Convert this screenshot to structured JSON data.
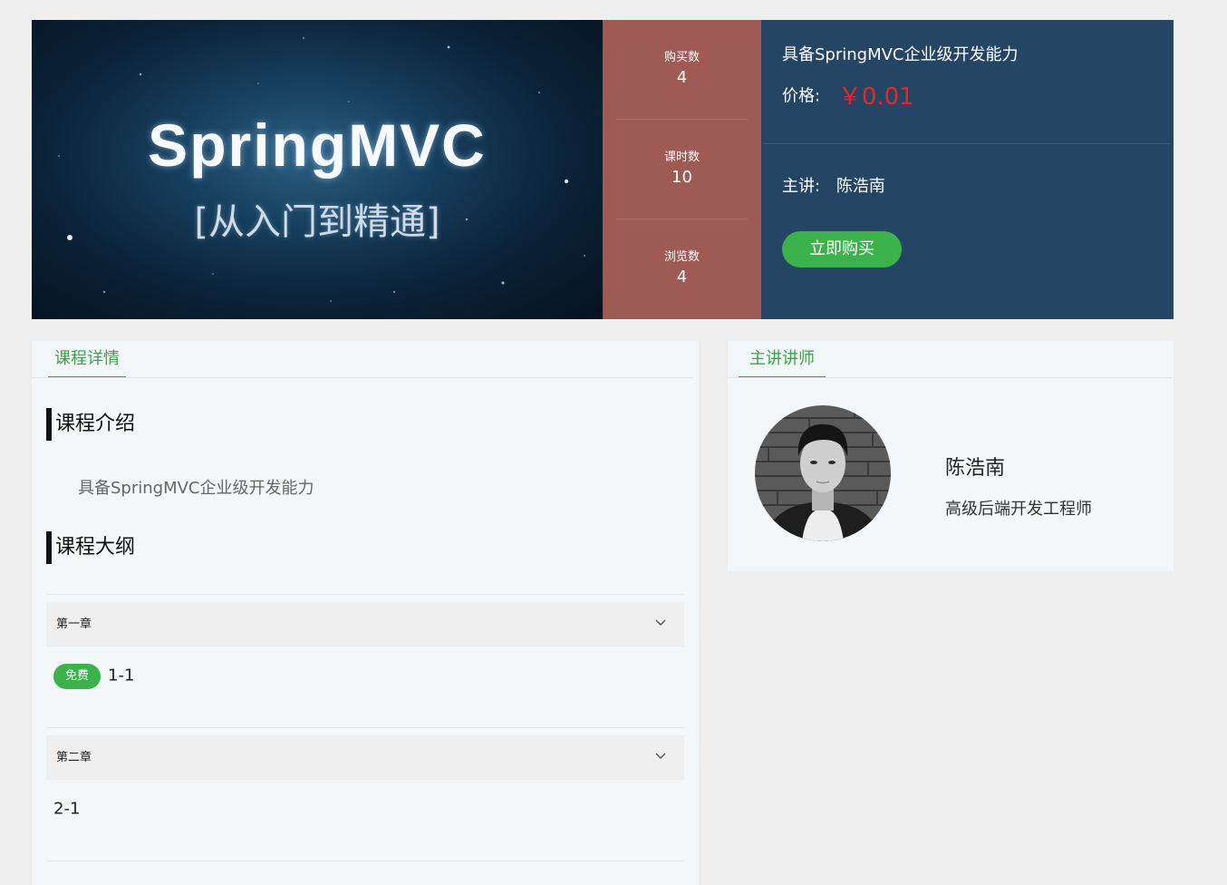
{
  "cover": {
    "title": "SpringMVC",
    "subtitle": "[从入门到精通]"
  },
  "stats": [
    {
      "label": "购买数",
      "value": "4"
    },
    {
      "label": "课时数",
      "value": "10"
    },
    {
      "label": "浏览数",
      "value": "4"
    }
  ],
  "info": {
    "title": "具备SpringMVC企业级开发能力",
    "price_label": "价格:",
    "price_value": "￥0.01",
    "teacher_label": "主讲:",
    "teacher_name": "陈浩南",
    "buy_button": "立即购买"
  },
  "detail_panel": {
    "tab": "课程详情",
    "intro_heading": "课程介绍",
    "intro_text": "具备SpringMVC企业级开发能力",
    "outline_heading": "课程大纲",
    "chapters": [
      {
        "title": "第一章",
        "lessons": [
          {
            "badge": "免费",
            "name": "1-1"
          }
        ]
      },
      {
        "title": "第二章",
        "lessons": [
          {
            "badge": "",
            "name": "2-1"
          }
        ]
      }
    ]
  },
  "teacher_panel": {
    "tab": "主讲讲师",
    "name": "陈浩南",
    "title": "高级后端开发工程师"
  },
  "colors": {
    "page_bg": "#eeeeee",
    "stats_bg": "#9f5a55",
    "info_bg": "#244564",
    "accent_green": "#3bb34a",
    "price_red": "#e8242f"
  },
  "icons": {
    "chapter_toggle": "chevron-down-icon"
  }
}
